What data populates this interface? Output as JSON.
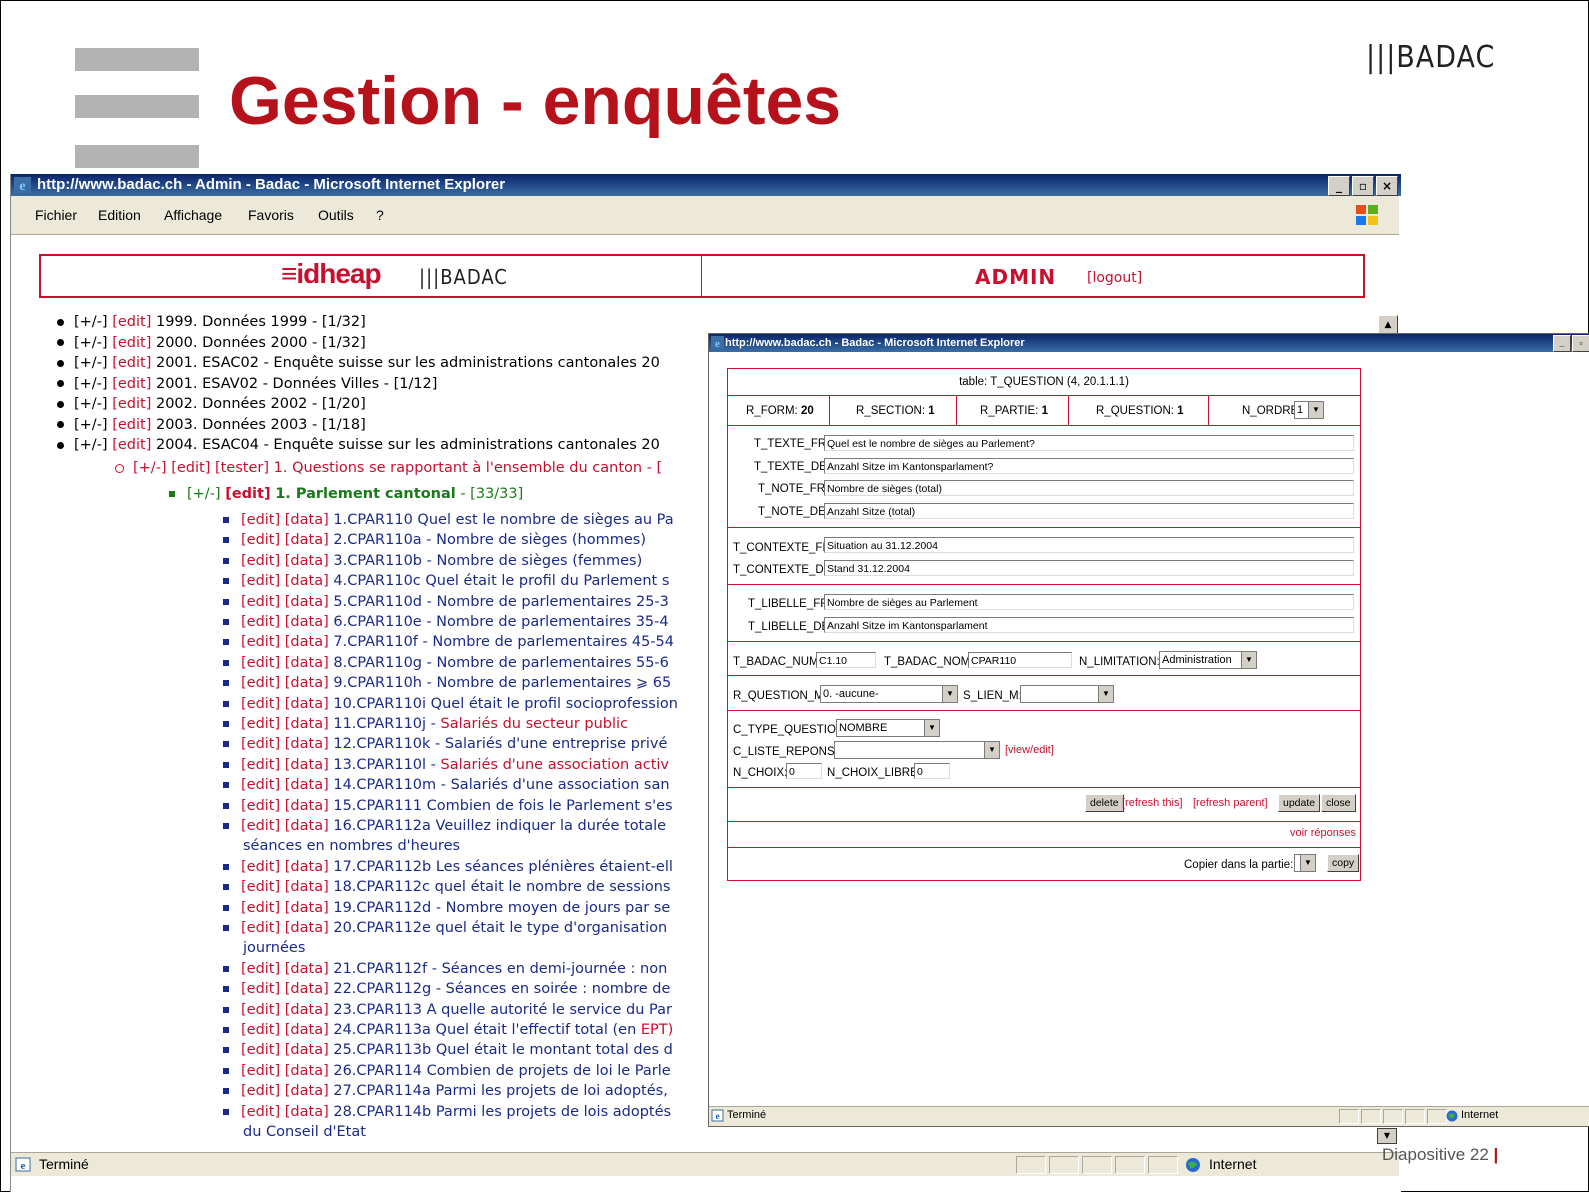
{
  "slide": {
    "title": "Gestion - enquêtes",
    "logo": "|||BADAC",
    "footer": "Diapositive 22",
    "footer_bar": "|"
  },
  "browser": {
    "title": "http://www.badac.ch - Admin - Badac - Microsoft Internet Explorer",
    "window_buttons": [
      "_",
      "▫",
      "×"
    ],
    "menu": [
      "Fichier",
      "Edition",
      "Affichage",
      "Favoris",
      "Outils",
      "?"
    ],
    "status_text": "Terminé",
    "status_zone": "Internet"
  },
  "header": {
    "idheap": "≡idheap",
    "badac": "|||BADAC",
    "admin": "ADMIN",
    "logout": "[logout]"
  },
  "tree": {
    "top_items": [
      {
        "pm": "[+/-]",
        "edit": "[edit]",
        "text": "1999. Données 1999 - [1/32]"
      },
      {
        "pm": "[+/-]",
        "edit": "[edit]",
        "text": "2000. Données 2000 - [1/32]"
      },
      {
        "pm": "[+/-]",
        "edit": "[edit]",
        "text": "2001. ESAC02 - Enquête suisse sur les administrations cantonales 20"
      },
      {
        "pm": "[+/-]",
        "edit": "[edit]",
        "text": "2001. ESAV02 - Données Villes - [1/12]"
      },
      {
        "pm": "[+/-]",
        "edit": "[edit]",
        "text": "2002. Données 2002 - [1/20]"
      },
      {
        "pm": "[+/-]",
        "edit": "[edit]",
        "text": "2003. Données 2003 - [1/18]"
      },
      {
        "pm": "[+/-]",
        "edit": "[edit]",
        "text": "2004. ESAC04 - Enquête suisse sur les administrations cantonales 20"
      }
    ],
    "section": {
      "pm": "[+/-]",
      "edit": "[edit]",
      "tester": "[tester]",
      "text": "1. Questions se rapportant à l'ensemble du canton - ["
    },
    "part": {
      "pm": "[+/-]",
      "edit": "[edit]",
      "label": "1. Parlement cantonal",
      "count": "- [33/33]"
    },
    "questions": [
      {
        "text": "1.CPAR110 Quel est le nombre de sièges au Pa"
      },
      {
        "text": "2.CPAR110a - Nombre de sièges (hommes)"
      },
      {
        "text": "3.CPAR110b - Nombre de sièges (femmes)"
      },
      {
        "text": "4.CPAR110c Quel était le profil du Parlement s"
      },
      {
        "text": "5.CPAR110d - Nombre de parlementaires 25-3"
      },
      {
        "text": "6.CPAR110e - Nombre de parlementaires 35-4"
      },
      {
        "text": "7.CPAR110f - Nombre de parlementaires 45-54"
      },
      {
        "text": "8.CPAR110g - Nombre de parlementaires 55-6"
      },
      {
        "text": "9.CPAR110h - Nombre de parlementaires ⩾ 65"
      },
      {
        "text": "10.CPAR110i Quel était le profil socioprofession"
      },
      {
        "text": "11.CPAR110j - ",
        "red": "Salariés du secteur public"
      },
      {
        "text": "12.CPAR110k - Salariés d'une entreprise privé"
      },
      {
        "text": "13.CPAR110l - ",
        "red": "Salariés d'une association activ"
      },
      {
        "text": "14.CPAR110m - Salariés d'une association san"
      },
      {
        "text": "15.CPAR111 Combien de fois le Parlement s'es"
      },
      {
        "text": "16.CPAR112a Veuillez indiquer la durée totale",
        "cont": "séances en nombres d'heures"
      },
      {
        "text": "17.CPAR112b Les séances plénières étaient-ell"
      },
      {
        "text": "18.CPAR112c quel était le nombre de sessions"
      },
      {
        "text": "19.CPAR112d - Nombre moyen de jours par se"
      },
      {
        "text": "20.CPAR112e quel était le type d'organisation",
        "cont": "journées"
      },
      {
        "text": "21.CPAR112f - Séances en demi-journée : non"
      },
      {
        "text": "22.CPAR112g - Séances en soirée : nombre de"
      },
      {
        "text": "23.CPAR113 A quelle autorité le service du Par"
      },
      {
        "text": "24.CPAR113a Quel était l'effectif total (en ",
        "red": "EPT)"
      },
      {
        "text": "25.CPAR113b Quel était le montant total des d"
      },
      {
        "text": "26.CPAR114 Combien de projets de loi le Parle"
      },
      {
        "text": "27.CPAR114a Parmi les projets de loi adoptés,"
      },
      {
        "text": "28.CPAR114b Parmi les projets de lois adoptés",
        "cont": "du Conseil d'Etat"
      }
    ],
    "edit": "[edit]",
    "data": "[data]"
  },
  "popup": {
    "title": "http://www.badac.ch - Badac - Microsoft Internet Explorer",
    "table_caption": "table: T_QUESTION (4, 20.1.1.1)",
    "r_form_label": "R_FORM:",
    "r_form": "20",
    "r_section_label": "R_SECTION:",
    "r_section": "1",
    "r_partie_label": "R_PARTIE:",
    "r_partie": "1",
    "r_question_label": "R_QUESTION:",
    "r_question": "1",
    "n_ordre_label": "N_ORDRE:",
    "n_ordre": "1",
    "t_texte_fr_label": "T_TEXTE_FR:",
    "t_texte_fr": "Quel est le nombre de sièges au Parlement?",
    "t_texte_de_label": "T_TEXTE_DE:",
    "t_texte_de": "Anzahl Sitze im Kantonsparlament?",
    "t_note_fr_label": "T_NOTE_FR:",
    "t_note_fr": "Nombre de sièges (total)",
    "t_note_de_label": "T_NOTE_DE:",
    "t_note_de": "Anzahl Sitze (total)",
    "t_contexte_fr_label": "T_CONTEXTE_FR:",
    "t_contexte_fr": "Situation au 31.12.2004",
    "t_contexte_de_label": "T_CONTEXTE_DE:",
    "t_contexte_de": "Stand 31.12.2004",
    "t_libelle_fr_label": "T_LIBELLE_FR:",
    "t_libelle_fr": "Nombre de sièges au Parlement",
    "t_libelle_de_label": "T_LIBELLE_DE:",
    "t_libelle_de": "Anzahl Sitze im Kantonsparlament",
    "t_badac_num_label": "T_BADAC_NUM:",
    "t_badac_num": "C1.10",
    "t_badac_nom_label": "T_BADAC_NOM:",
    "t_badac_nom": "CPAR110",
    "n_limitation_label": "N_LIMITATION:",
    "n_limitation": "Administration",
    "r_question_m_label": "R_QUESTION_M:",
    "r_question_m": "0. -aucune-",
    "s_lien_m_label": "S_LIEN_M:",
    "s_lien_m": "",
    "c_type_question_label": "C_TYPE_QUESTION:",
    "c_type_question": "NOMBRE",
    "c_liste_reponse_label": "C_LISTE_REPONSE:",
    "c_liste_reponse": "",
    "view_edit": "[view/edit]",
    "n_choix_label": "N_CHOIX:",
    "n_choix": "0",
    "n_choix_libre_label": "N_CHOIX_LIBRE:",
    "n_choix_libre": "0",
    "delete": "delete",
    "refresh_this": "[refresh this]",
    "refresh_parent": "[refresh parent]",
    "update": "update",
    "close": "close",
    "voir_reponses": "voir réponses",
    "copier_label": "Copier dans la partie:",
    "copy": "copy",
    "status_text": "Terminé",
    "status_zone": "Internet"
  }
}
